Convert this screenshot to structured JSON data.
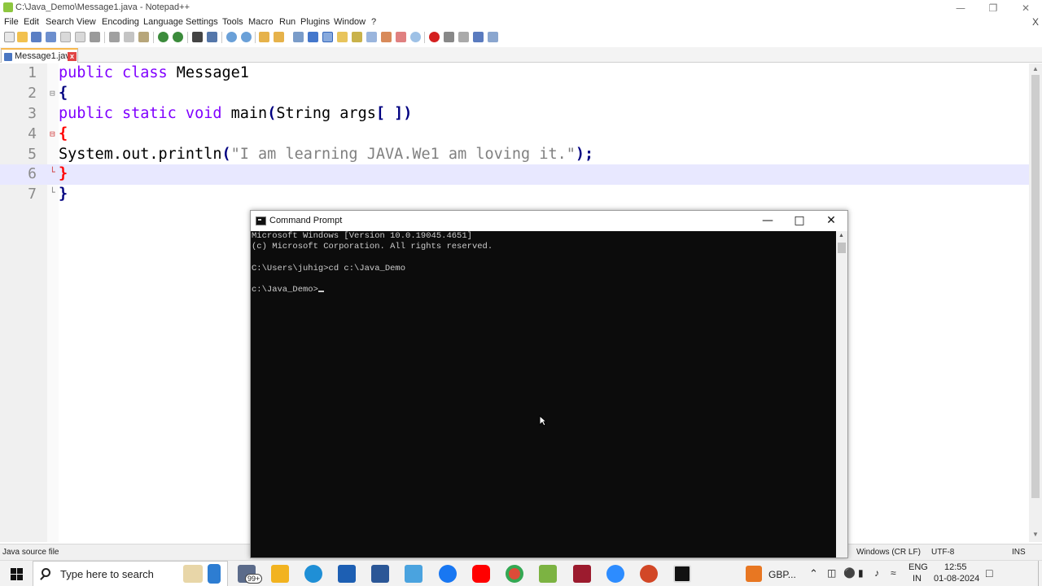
{
  "npp": {
    "title": "C:\\Java_Demo\\Message1.java - Notepad++",
    "menu": [
      "File",
      "Edit",
      "Search",
      "View",
      "Encoding",
      "Language",
      "Settings",
      "Tools",
      "Macro",
      "Run",
      "Plugins",
      "Window",
      "?"
    ],
    "close_doc": "X",
    "tab_label": "Message1.java",
    "tab_close": "x",
    "line_numbers": [
      "1",
      "2",
      "3",
      "4",
      "5",
      "6",
      "7"
    ],
    "code": {
      "l1_kw": "public class",
      "l1_name": " Message1",
      "l2_brace": "{",
      "l3_kw1": "public static void",
      "l3_rest": " main",
      "l3_paren": "(",
      "l3_params": "String args",
      "l3_brackets": "[ ]",
      "l3_close": ")",
      "l4_brace": "{",
      "l5_start": "System.out.println",
      "l5_open": "(",
      "l5_str": "\"I am learning JAVA.We1 am loving it.\"",
      "l5_close": ");",
      "l6_brace": "}",
      "l7_brace": "}"
    },
    "status": {
      "file_type": "Java source file",
      "eol": "Windows (CR LF)",
      "encoding": "UTF-8",
      "mode": "INS"
    }
  },
  "cmd": {
    "title": "Command Prompt",
    "lines": [
      "Microsoft Windows [Version 10.0.19045.4651]",
      "(c) Microsoft Corporation. All rights reserved.",
      "",
      "C:\\Users\\juhig>cd c:\\Java_Demo",
      "",
      "c:\\Java_Demo>"
    ]
  },
  "taskbar": {
    "search_placeholder": "Type here to search",
    "badge": "99+",
    "weather": "GBP...",
    "lang_top": "ENG",
    "lang_bottom": "IN",
    "time": "12:55",
    "date": "01-08-2024"
  },
  "colors": {
    "keyword": "#8000ff",
    "string": "#808080",
    "brace": "#000080",
    "current_line": "#e8e8ff",
    "cmd_bg": "#0c0c0c"
  }
}
